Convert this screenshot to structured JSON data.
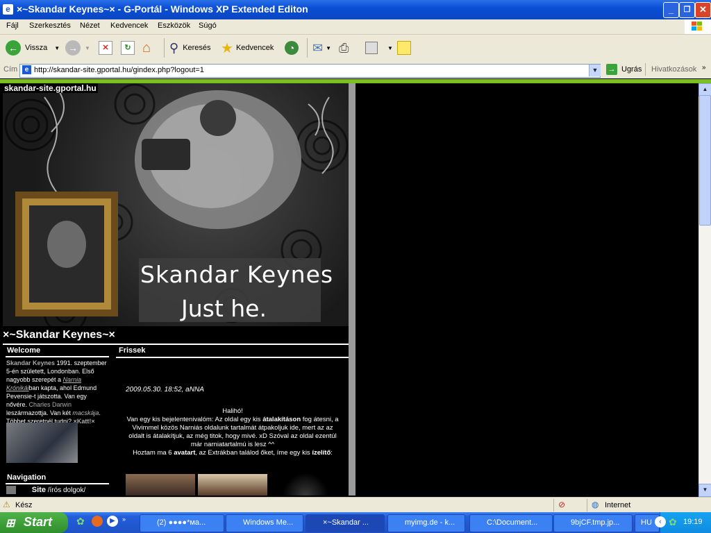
{
  "window": {
    "title": "×~Skandar Keynes~× - G-Portál - Windows XP Extended Editon",
    "controls": {
      "minimize": "_",
      "maximize": "❐",
      "close": "✕"
    }
  },
  "menubar": [
    "Fájl",
    "Szerkesztés",
    "Nézet",
    "Kedvencek",
    "Eszközök",
    "Súgó"
  ],
  "toolbar": {
    "back": "Vissza",
    "search": "Keresés",
    "favorites": "Kedvencek"
  },
  "addressbar": {
    "label": "Cím",
    "url": "http://skandar-site.gportal.hu/gindex.php?logout=1",
    "go": "Ugrás",
    "links": "Hivatkozások"
  },
  "page": {
    "site_label": "skandar-site.gportal.hu",
    "banner_line1": "Skandar Keynes",
    "banner_line2": "Just he.",
    "heading": "×~Skandar Keynes~×",
    "welcome": {
      "title": "Welcome",
      "name_link": "Skandar Keynes",
      "text1": " 1991. szeptember 5-én született, Londonban. Első nagyobb szerepét a ",
      "narnia_link": "Narnia Krónikái",
      "text2": "ban kapta, ahol Edmund Pevensie-t játszotta. Van egy nővére. ",
      "charles_link": "Charles Darwin",
      "text3": " leszármazottja. Van két ",
      "cats_link": "macskája",
      "text4": ". Többet szeretnél tudni? ",
      "katt_link": "×Katt!×"
    },
    "navigation": {
      "title": "Navigation",
      "item_bold": "Site",
      "item_rest": " /írós dolgok/"
    },
    "frissek": {
      "title": "Frissek",
      "date": "2009.05.30. 18:52, aNNA",
      "greeting": "Halihó!",
      "p1a": "Van egy kis bejelentenivalóm: Az oldal egy kis ",
      "p1b": "átalakításon",
      "p1c": " fog átesni, a Vivimmel közös Narniás oldalunk tartalmát átpakoljuk ide, mert az az oldalt is átalakítjuk, az még titok, hogy mivé. xD Szóval az oldal ezentúl már narniatartalmú is lesz ^^",
      "p2a": "Hoztam ma 6 ",
      "p2b": "avatart",
      "p2c": ", az Extrákban találod őket, íme egy kis ",
      "p2d": "ízelítő",
      "p2e": ":"
    }
  },
  "statusbar": {
    "text": "Kész",
    "zone": "Internet"
  },
  "taskbar": {
    "start": "Start",
    "tasks": [
      "(2) ●●●●*ма...",
      "Windows Me...",
      "×~Skandar ...",
      "myimg.de - k...",
      "C:\\Document...",
      "9bjCF.tmp.jp...",
      "HU"
    ],
    "clock": "19:19"
  },
  "colors": {
    "xp_blue": "#0a4fd6",
    "chrome": "#ece9d8",
    "green_strip": "#7cbf22"
  }
}
